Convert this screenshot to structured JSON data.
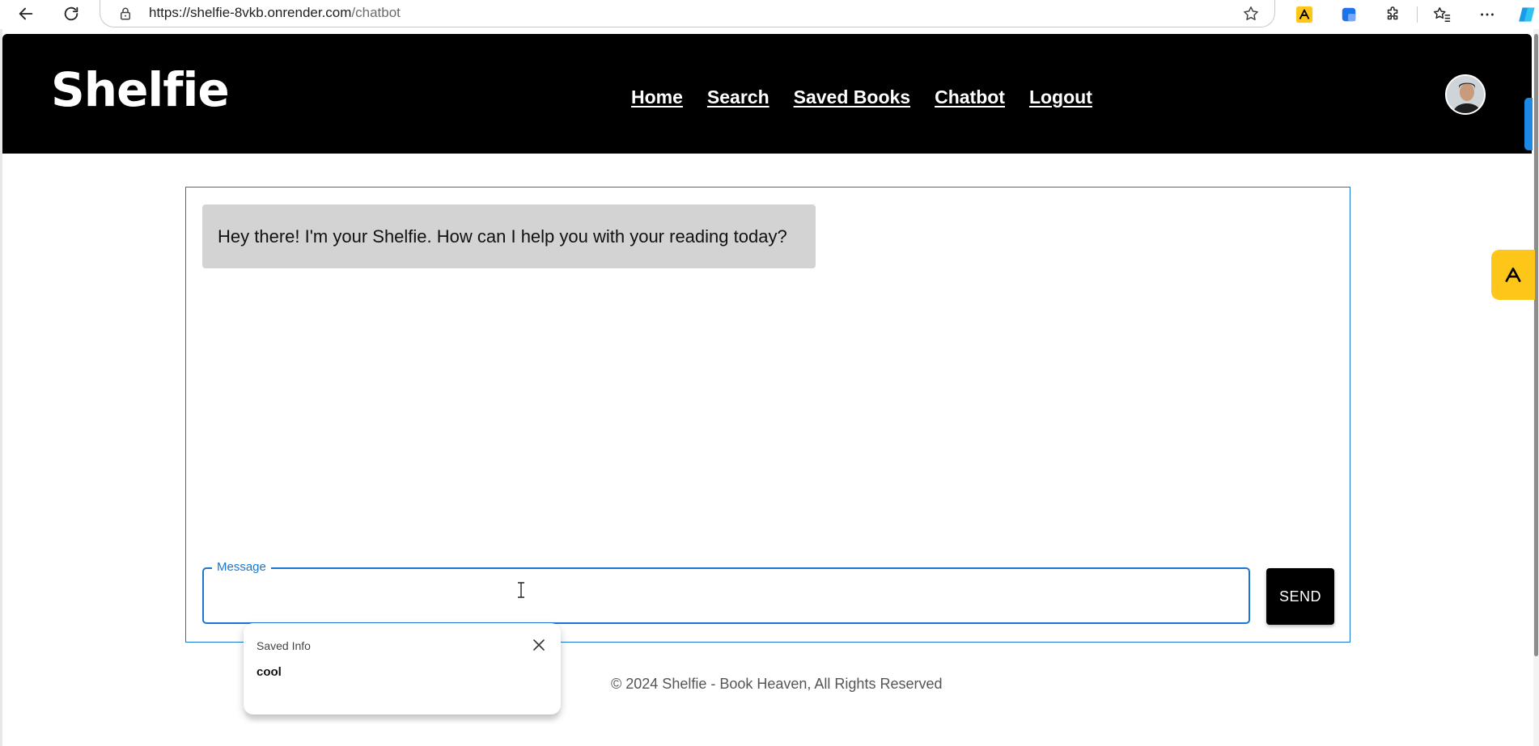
{
  "browser": {
    "url_host": "https://shelfie-8vkb.onrender.com",
    "url_path": "/chatbot",
    "icons": [
      "back-icon",
      "refresh-icon",
      "lock-icon",
      "star-icon",
      "extension-icon",
      "favorites-icon",
      "more-icon"
    ]
  },
  "header": {
    "logo": "Shelfie",
    "nav": [
      {
        "label": "Home"
      },
      {
        "label": "Search"
      },
      {
        "label": "Saved Books"
      },
      {
        "label": "Chatbot"
      },
      {
        "label": "Logout"
      }
    ]
  },
  "chat": {
    "messages": [
      {
        "role": "bot",
        "text": "Hey there! I'm your Shelfie. How can I help you with your reading today?"
      }
    ],
    "input_label": "Message",
    "input_value": "",
    "send_label": "SEND"
  },
  "saved_popup": {
    "title": "Saved Info",
    "value": "cool"
  },
  "footer": {
    "text": "© 2024 Shelfie - Book Heaven, All Rights Reserved"
  },
  "colors": {
    "header_bg": "#000000",
    "accent": "#1976d2",
    "bot_bubble": "#d3d3d3",
    "side_widget": "#ffc61a"
  }
}
